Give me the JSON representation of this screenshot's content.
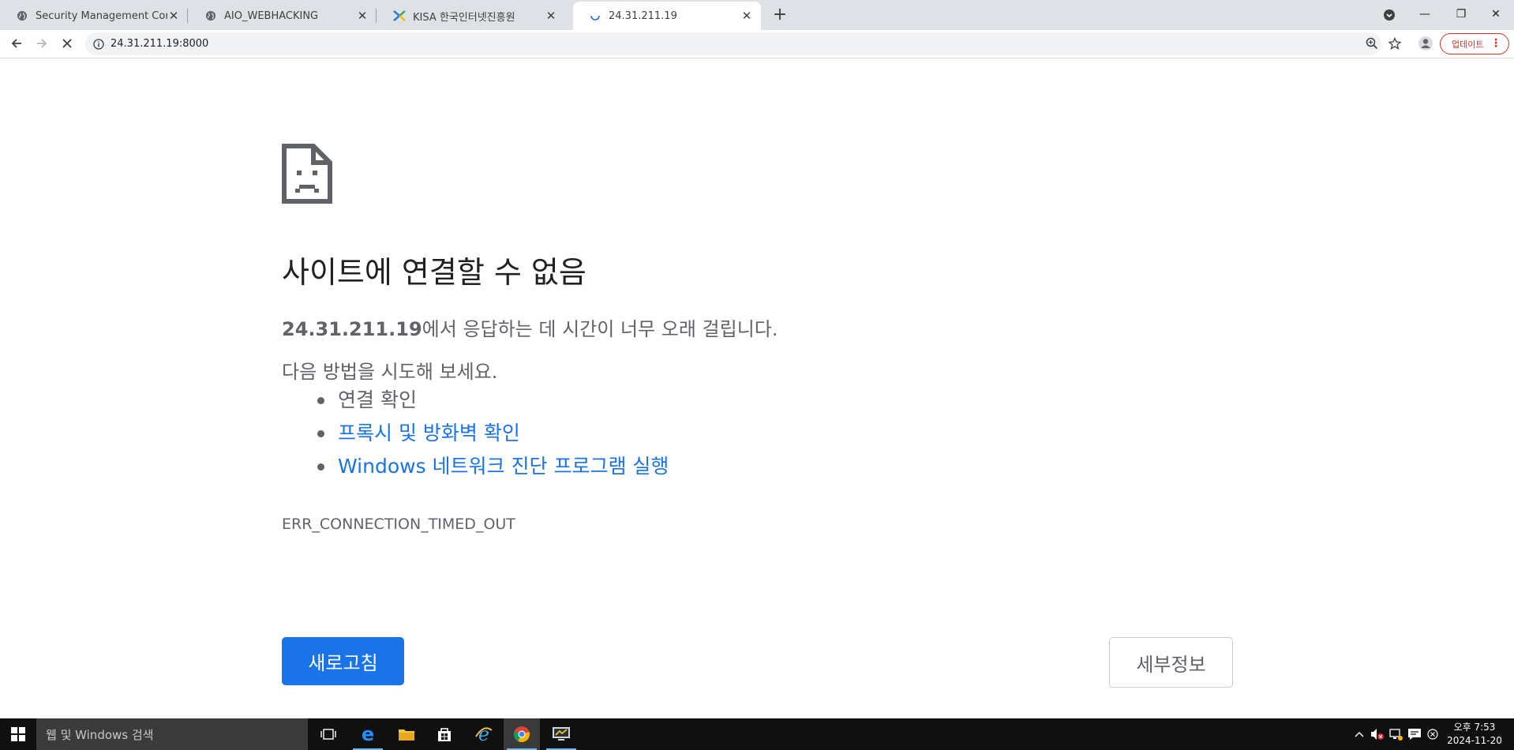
{
  "tabs": [
    {
      "title": "Security Management Console",
      "favicon": "globe-icon",
      "active": false
    },
    {
      "title": "AIO_WEBHACKING",
      "favicon": "globe-icon",
      "active": false
    },
    {
      "title": "KISA 한국인터넷진흥원",
      "favicon": "kisa-logo-icon",
      "active": false
    },
    {
      "title": "24.31.211.19",
      "favicon": "loading-spinner-icon",
      "active": true
    }
  ],
  "tab_close_glyph": "✕",
  "new_tab_glyph": "+",
  "window_controls": {
    "minimize": "—",
    "restore": "❐",
    "close": "✕"
  },
  "toolbar": {
    "url": "24.31.211.19:8000",
    "update_label": "업데이트",
    "menu_glyph": "⋮"
  },
  "error_page": {
    "heading": "사이트에 연결할 수 없음",
    "host": "24.31.211.19",
    "summary_suffix": "에서 응답하는 데 시간이 너무 오래 걸립니다.",
    "try_label": "다음 방법을 시도해 보세요.",
    "suggestions": [
      {
        "text": "연결 확인",
        "link": false
      },
      {
        "text": "프록시 및 방화벽 확인",
        "link": true
      },
      {
        "text": "Windows 네트워크 진단 프로그램 실행",
        "link": true
      }
    ],
    "error_code": "ERR_CONNECTION_TIMED_OUT",
    "reload_label": "새로고침",
    "details_label": "세부정보"
  },
  "taskbar": {
    "search_placeholder": "웹 및 Windows 검색",
    "apps": [
      "task-view-icon",
      "edge-icon",
      "file-explorer-icon",
      "store-icon",
      "internet-explorer-icon",
      "chrome-icon",
      "remote-desktop-icon"
    ],
    "clock_time": "오후 7:53",
    "clock_date": "2024-11-20"
  },
  "colors": {
    "accent_blue": "#1a73e8",
    "update_red": "#d93025",
    "text_gray": "#5f6368"
  }
}
